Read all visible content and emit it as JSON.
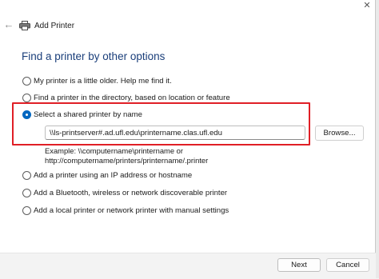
{
  "window": {
    "title": "Add Printer",
    "back_glyph": "←",
    "close_glyph": "✕"
  },
  "heading": "Find a printer by other options",
  "options": [
    {
      "label": "My printer is a little older. Help me find it.",
      "selected": false
    },
    {
      "label": "Find a printer in the directory, based on location or feature",
      "selected": false
    },
    {
      "label": "Select a shared printer by name",
      "selected": true
    },
    {
      "label": "Add a printer using an IP address or hostname",
      "selected": false
    },
    {
      "label": "Add a Bluetooth, wireless or network discoverable printer",
      "selected": false
    },
    {
      "label": "Add a local printer or network printer with manual settings",
      "selected": false
    }
  ],
  "shared_printer": {
    "value": "\\\\ls-printserver#.ad.ufl.edu\\printername.clas.ufl.edu",
    "browse_label": "Browse...",
    "example_line1": "Example: \\\\computername\\printername or",
    "example_line2": "http://computername/printers/printername/.printer"
  },
  "footer": {
    "next_label": "Next",
    "cancel_label": "Cancel"
  },
  "colors": {
    "heading": "#1a3e7a",
    "highlight_box": "#e01f26",
    "radio_selected": "#0067c0"
  },
  "icons": {
    "back": "back-arrow-icon",
    "printer": "printer-icon",
    "close": "close-icon"
  }
}
